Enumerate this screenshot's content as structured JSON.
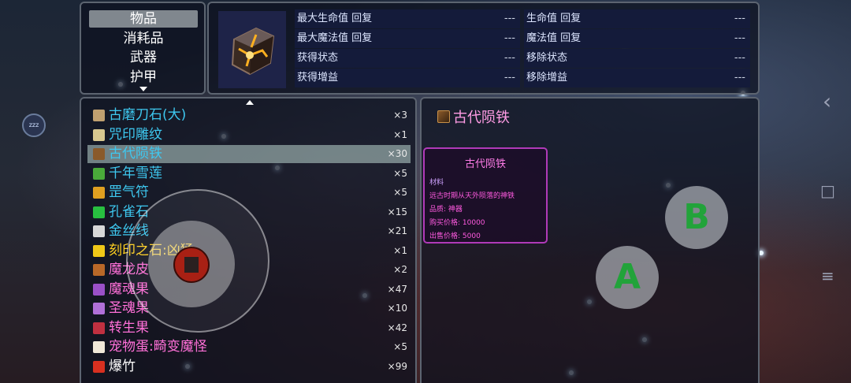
{
  "categories": {
    "items": [
      "物品",
      "消耗品",
      "武器",
      "护甲"
    ],
    "selected_index": 0
  },
  "detail": {
    "rows": [
      {
        "left_label": "最大生命值 回复",
        "left_value": "---",
        "right_label": "生命值 回复",
        "right_value": "---"
      },
      {
        "left_label": "最大魔法值 回复",
        "left_value": "---",
        "right_label": "魔法值 回复",
        "right_value": "---"
      },
      {
        "left_label": "获得状态",
        "left_value": "---",
        "right_label": "移除状态",
        "right_value": "---"
      },
      {
        "left_label": "获得增益",
        "left_value": "---",
        "right_label": "移除增益",
        "right_value": "---"
      }
    ]
  },
  "inventory": {
    "items": [
      {
        "name": "古磨刀石(大)",
        "qty": "×3",
        "color": "#3ec8f0",
        "icon": "whetstone-icon",
        "icon_color": "#c0a070"
      },
      {
        "name": "咒印雕纹",
        "qty": "×1",
        "color": "#3ec8f0",
        "icon": "scroll-icon",
        "icon_color": "#d8c890"
      },
      {
        "name": "古代陨铁",
        "qty": "×30",
        "color": "#3ec8f0",
        "icon": "meteorite-icon",
        "icon_color": "#8a5a2a"
      },
      {
        "name": "千年雪莲",
        "qty": "×5",
        "color": "#3ec8f0",
        "icon": "snow-lotus-icon",
        "icon_color": "#4aaa3a"
      },
      {
        "name": "罡气符",
        "qty": "×5",
        "color": "#3ec8f0",
        "icon": "talisman-icon",
        "icon_color": "#e0a020"
      },
      {
        "name": "孔雀石",
        "qty": "×15",
        "color": "#3ec8f0",
        "icon": "malachite-icon",
        "icon_color": "#28c040"
      },
      {
        "name": "金丝线",
        "qty": "×21",
        "color": "#3ec8f0",
        "icon": "gold-thread-icon",
        "icon_color": "#d8d8d8"
      },
      {
        "name": "刻印之石:凶猛",
        "qty": "×1",
        "color": "#ffd020",
        "icon": "engraving-stone-icon",
        "icon_color": "#f0c818"
      },
      {
        "name": "魔龙皮",
        "qty": "×2",
        "color": "#ff70d8",
        "icon": "dragon-hide-icon",
        "icon_color": "#b86828"
      },
      {
        "name": "魔魂果",
        "qty": "×47",
        "color": "#ff70d8",
        "icon": "demon-soul-fruit-icon",
        "icon_color": "#9a50c8"
      },
      {
        "name": "圣魂果",
        "qty": "×10",
        "color": "#ff70d8",
        "icon": "holy-soul-fruit-icon",
        "icon_color": "#b070d8"
      },
      {
        "name": "转生果",
        "qty": "×42",
        "color": "#ff70d8",
        "icon": "rebirth-fruit-icon",
        "icon_color": "#c03040"
      },
      {
        "name": "宠物蛋:畸变魔怪",
        "qty": "×5",
        "color": "#ff70d8",
        "icon": "pet-egg-icon",
        "icon_color": "#f0e8d8"
      },
      {
        "name": "爆竹",
        "qty": "×99",
        "color": "#ffffff",
        "icon": "firecracker-icon",
        "icon_color": "#d83020"
      }
    ],
    "selected_index": 2
  },
  "info": {
    "title": "古代陨铁",
    "tooltip": {
      "title": "古代陨铁",
      "category": "材料",
      "description": "远古时期从天外陨落的神铁",
      "quality": "品质: 神器",
      "buy_price": "购买价格: 10000",
      "sell_price": "出售价格: 5000"
    }
  },
  "controls": {
    "a_label": "A",
    "b_label": "B",
    "status_badge": "zzz"
  },
  "nav": {
    "back": "‹",
    "home": "□",
    "menu": "≡"
  }
}
